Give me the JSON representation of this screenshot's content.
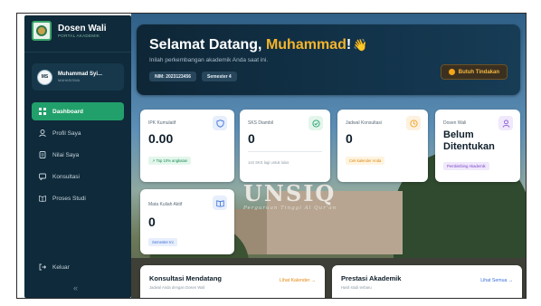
{
  "sidebar": {
    "brand_title": "Dosen Wali",
    "brand_subtitle": "PORTAL AKADEMIK",
    "user": {
      "initials": "MS",
      "name": "Muhammad Syi...",
      "role": "MAHASISWA"
    },
    "items": [
      {
        "label": "Dashboard",
        "icon": "grid-icon"
      },
      {
        "label": "Profil Saya",
        "icon": "user-icon"
      },
      {
        "label": "Nilai Saya",
        "icon": "document-icon"
      },
      {
        "label": "Konsultasi",
        "icon": "chat-icon"
      },
      {
        "label": "Proses Studi",
        "icon": "book-icon"
      }
    ],
    "logout": "Keluar",
    "collapse_glyph": "«"
  },
  "background": {
    "sign_text": "UNSIQ",
    "sign_sub": "Perguruan Tinggi Al Qur'an"
  },
  "banner": {
    "greeting": "Selamat Datang, ",
    "name": "Muhammad",
    "exclaim": "!",
    "wave": "👋",
    "subtitle": "Inilah perkembangan akademik Anda saat ini.",
    "chips": [
      "NIM: 2023123456",
      "Semester 4"
    ],
    "action": "Butuh Tindakan"
  },
  "cards": {
    "ipk": {
      "title": "IPK Kumulatif",
      "value": "0.00",
      "pill": "↗ Top 10% angkatan"
    },
    "sks": {
      "title": "SKS Diambil",
      "value": "0",
      "note": "144 SKS lagi untuk lulus"
    },
    "jadwal": {
      "title": "Jadwal Konsultasi",
      "value": "0",
      "pill": "Cek kalender Anda"
    },
    "dosen": {
      "title": "Dosen Wali",
      "value_line1": "Belum",
      "value_line2": "Ditentukan",
      "pill": "Pembimbing Akademik"
    },
    "matkul": {
      "title": "Mata Kuliah Aktif",
      "value": "0",
      "pill": "Semester Ini"
    }
  },
  "panels": {
    "konsultasi": {
      "title": "Konsultasi Mendatang",
      "subtitle": "Jadwal Anda dengan Dosen Wali",
      "link": "Lihat Kalender →"
    },
    "prestasi": {
      "title": "Prestasi Akademik",
      "subtitle": "Hasil studi terbaru",
      "link": "Lihat Semua →"
    }
  },
  "colors": {
    "accent_green": "#22a06b",
    "accent_orange": "#f5b42a",
    "sidebar_bg": "#0f2a3a"
  }
}
